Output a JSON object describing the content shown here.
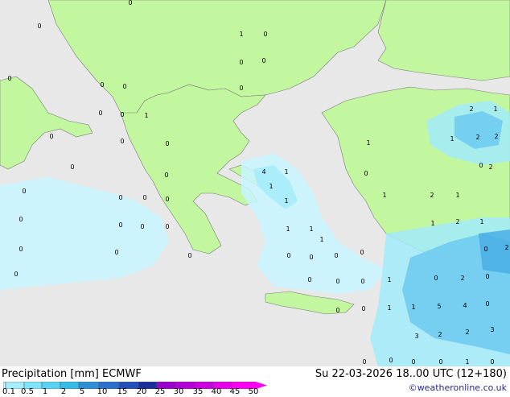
{
  "header": {
    "title": "Precipitation [mm] ECMWF",
    "datetime": "Su 22-03-2026 18..00 UTC (12+180)",
    "credit": "©weatheronline.co.uk"
  },
  "legend": {
    "ticks": [
      "0.1",
      "0.5",
      "1",
      "2",
      "5",
      "10",
      "15",
      "20",
      "25",
      "30",
      "35",
      "40",
      "45",
      "50"
    ],
    "colors": [
      "#c8f3ff",
      "#a6ecfd",
      "#7fe3fa",
      "#56d2f5",
      "#33bbe9",
      "#2f8fd6",
      "#2d6fcc",
      "#234fb8",
      "#1a2e9e",
      "#9900cc",
      "#b300d6",
      "#cc00e0",
      "#e600ea",
      "#ff00f5"
    ]
  },
  "colors": {
    "sea": "#e8e8e8",
    "land": "#c2f7a0",
    "precip_light": "#c8f5ff",
    "precip_mid": "#a3ebfa",
    "precip_heavy": "#6cc9f0",
    "precip_max": "#49aee6"
  },
  "map": {
    "values": [
      {
        "t": "0"
      },
      {
        "t": "0"
      },
      {
        "t": "0"
      },
      {
        "t": "0"
      },
      {
        "t": "0"
      },
      {
        "t": "0"
      },
      {
        "t": "0"
      },
      {
        "t": "1"
      },
      {
        "t": "0"
      },
      {
        "t": "0"
      },
      {
        "t": "0"
      },
      {
        "t": "0"
      },
      {
        "t": "0"
      },
      {
        "t": "1"
      },
      {
        "t": "0"
      },
      {
        "t": "0"
      },
      {
        "t": "0"
      },
      {
        "t": "0"
      },
      {
        "t": "0"
      },
      {
        "t": "0"
      },
      {
        "t": "0"
      },
      {
        "t": "0"
      },
      {
        "t": "0"
      },
      {
        "t": "0"
      },
      {
        "t": "0"
      },
      {
        "t": "0"
      },
      {
        "t": "0"
      },
      {
        "t": "0"
      },
      {
        "t": "0"
      },
      {
        "t": "0"
      },
      {
        "t": "4"
      },
      {
        "t": "1"
      },
      {
        "t": "1"
      },
      {
        "t": "1"
      },
      {
        "t": "1"
      },
      {
        "t": "1"
      },
      {
        "t": "1"
      },
      {
        "t": "0"
      },
      {
        "t": "0"
      },
      {
        "t": "0"
      },
      {
        "t": "0"
      },
      {
        "t": "0"
      },
      {
        "t": "0"
      },
      {
        "t": "0"
      },
      {
        "t": "1"
      },
      {
        "t": "1"
      },
      {
        "t": "1"
      },
      {
        "t": "0"
      },
      {
        "t": "0"
      },
      {
        "t": "1"
      },
      {
        "t": "2"
      },
      {
        "t": "1"
      },
      {
        "t": "2"
      },
      {
        "t": "1"
      },
      {
        "t": "1"
      },
      {
        "t": "1"
      },
      {
        "t": "0"
      },
      {
        "t": "0"
      },
      {
        "t": "2"
      },
      {
        "t": "0"
      },
      {
        "t": "2"
      },
      {
        "t": "0"
      },
      {
        "t": "2"
      },
      {
        "t": "0"
      },
      {
        "t": "0"
      },
      {
        "t": "5"
      },
      {
        "t": "4"
      },
      {
        "t": "3"
      },
      {
        "t": "2"
      },
      {
        "t": "2"
      },
      {
        "t": "3"
      },
      {
        "t": "2"
      },
      {
        "t": "1"
      },
      {
        "t": "1"
      },
      {
        "t": "2"
      },
      {
        "t": "2"
      },
      {
        "t": "0"
      },
      {
        "t": "1"
      },
      {
        "t": "0"
      },
      {
        "t": "0"
      },
      {
        "t": "0"
      },
      {
        "t": "0"
      }
    ]
  }
}
